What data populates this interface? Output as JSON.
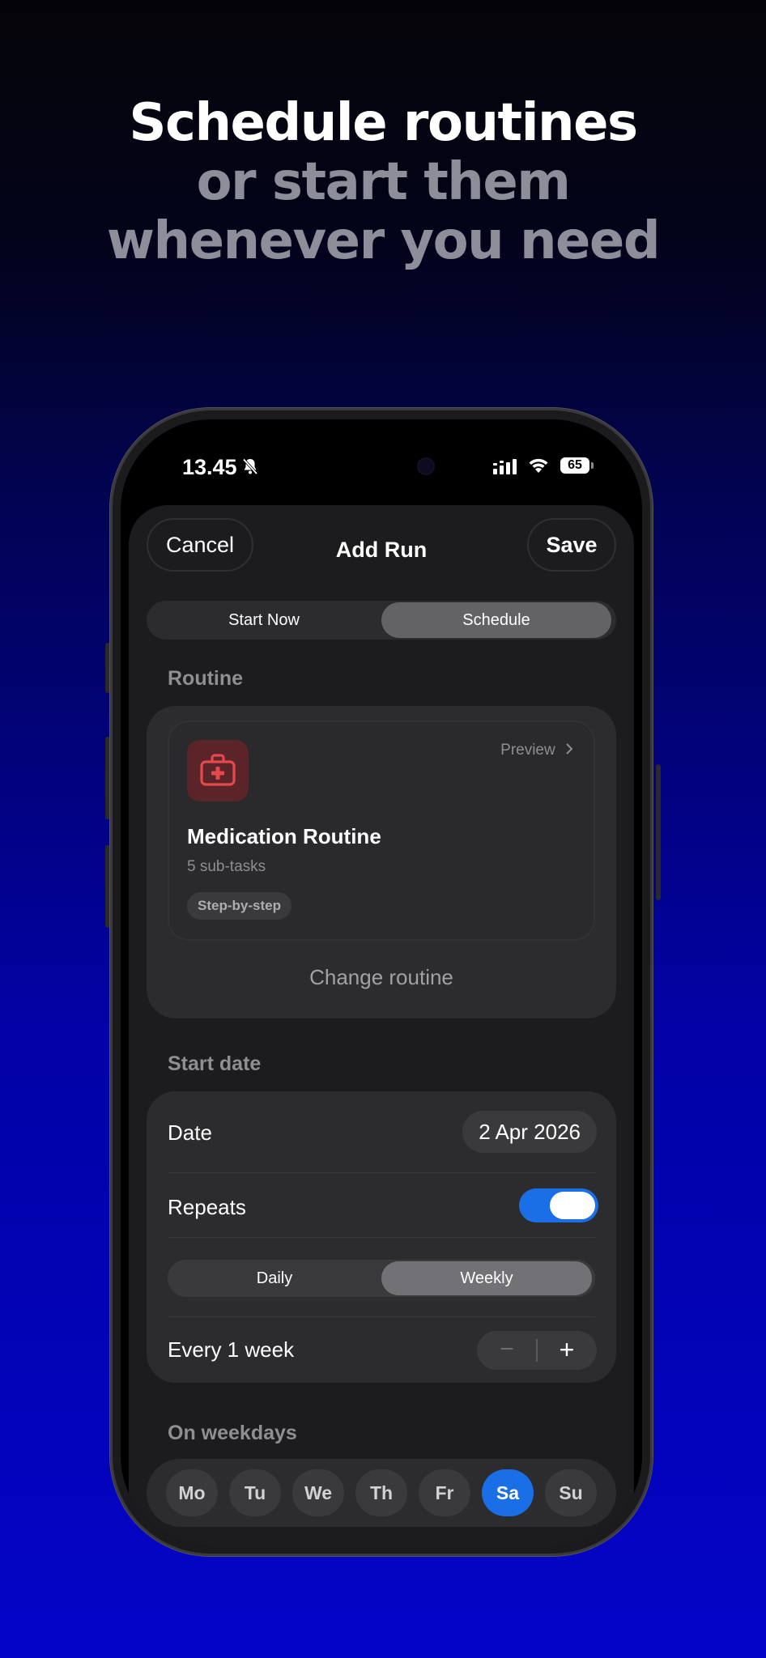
{
  "headline": {
    "line1": "Schedule routines",
    "line2": "or start them",
    "line3": "whenever you need"
  },
  "status_bar": {
    "time": "13.45",
    "battery": "65"
  },
  "header": {
    "cancel": "Cancel",
    "title": "Add Run",
    "save": "Save"
  },
  "mode_tabs": [
    {
      "label": "Start Now",
      "selected": false
    },
    {
      "label": "Schedule",
      "selected": true
    }
  ],
  "routine": {
    "section_label": "Routine",
    "preview": "Preview",
    "name": "Medication Routine",
    "subtasks": "5 sub-tasks",
    "tag": "Step-by-step",
    "change": "Change routine",
    "icon": "medical-kit-icon",
    "icon_color": "#e5484d"
  },
  "start_date": {
    "section_label": "Start date",
    "date_label": "Date",
    "date_value": "2 Apr 2026",
    "repeats_label": "Repeats",
    "repeats_on": true,
    "frequency": [
      {
        "label": "Daily",
        "selected": false
      },
      {
        "label": "Weekly",
        "selected": true
      }
    ],
    "interval_label": "Every 1 week",
    "stepper_minus": "−",
    "stepper_plus": "+"
  },
  "weekdays": {
    "section_label": "On weekdays",
    "days": [
      {
        "label": "Mo",
        "selected": false
      },
      {
        "label": "Tu",
        "selected": false
      },
      {
        "label": "We",
        "selected": false
      },
      {
        "label": "Th",
        "selected": false
      },
      {
        "label": "Fr",
        "selected": false
      },
      {
        "label": "Sa",
        "selected": true
      },
      {
        "label": "Su",
        "selected": false
      }
    ]
  },
  "colors": {
    "accent": "#1a6ee6",
    "sheet": "#1c1c1e",
    "card": "#2c2c2e"
  }
}
